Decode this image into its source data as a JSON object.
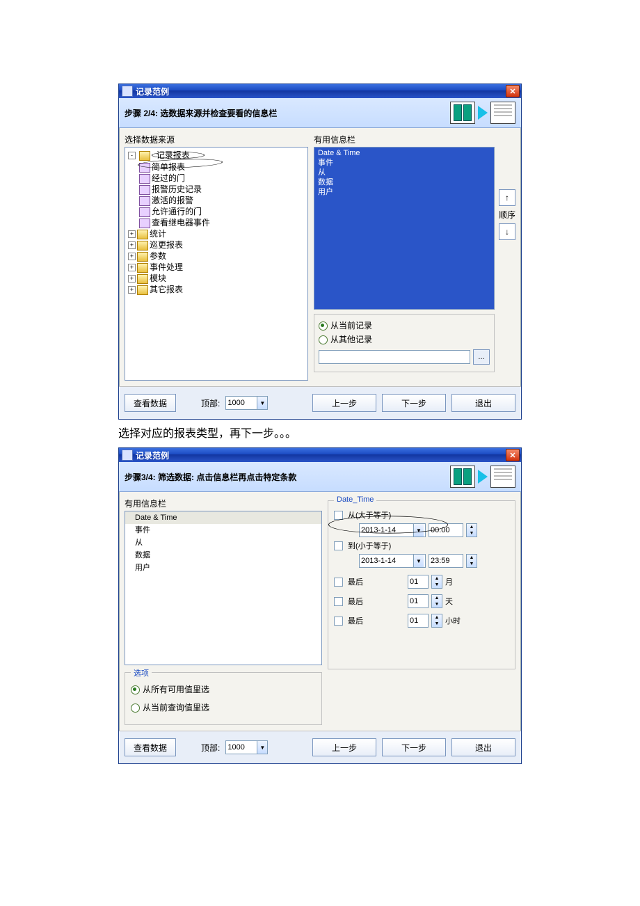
{
  "caption_between": "选择对应的报表类型，再下一步。。。",
  "window1": {
    "title": "记录范例",
    "step_label": "步骤 2/4: 选数据来源并检查要看的信息栏",
    "left_label": "选择数据来源",
    "tree": {
      "root": "记录报表",
      "children": [
        "简单报表",
        "经过的门",
        "报警历史记录",
        "激活的报警",
        "允许通行的门",
        "查看继电器事件"
      ],
      "siblings": [
        "统计",
        "巡更报表",
        "参数",
        "事件处理",
        "模块",
        "其它报表"
      ]
    },
    "right_label": "有用信息栏",
    "columns": [
      "Date & Time",
      "事件",
      "从",
      "数据",
      "用户"
    ],
    "radio1": "从当前记录",
    "radio2": "从其他记录",
    "order_label": "顺序",
    "view_btn": "查看数据",
    "top_label": "顶部:",
    "top_value": "1000",
    "prev": "上一步",
    "next": "下一步",
    "exit": "退出"
  },
  "window2": {
    "title": "记录范例",
    "step_label": "步骤3/4: 筛选数据: 点击信息栏再点击特定条款",
    "left_label": "有用信息栏",
    "columns": [
      "Date & Time",
      "事件",
      "从",
      "数据",
      "用户"
    ],
    "options_label": "选项",
    "opt1": "从所有可用值里选",
    "opt2": "从当前查询值里选",
    "filter_label": "Date_Time",
    "from_chk": "从(大于等于)",
    "to_chk": "到(小于等于)",
    "date_from": "2013-1-14",
    "time_from": "00:00",
    "date_to": "2013-1-14",
    "time_to": "23:59",
    "last_label": "最后",
    "last_month_val": "01",
    "last_month_unit": "月",
    "last_day_val": "01",
    "last_day_unit": "天",
    "last_hour_val": "01",
    "last_hour_unit": "小时",
    "view_btn": "查看数据",
    "top_label": "顶部:",
    "top_value": "1000",
    "prev": "上一步",
    "next": "下一步",
    "exit": "退出"
  }
}
